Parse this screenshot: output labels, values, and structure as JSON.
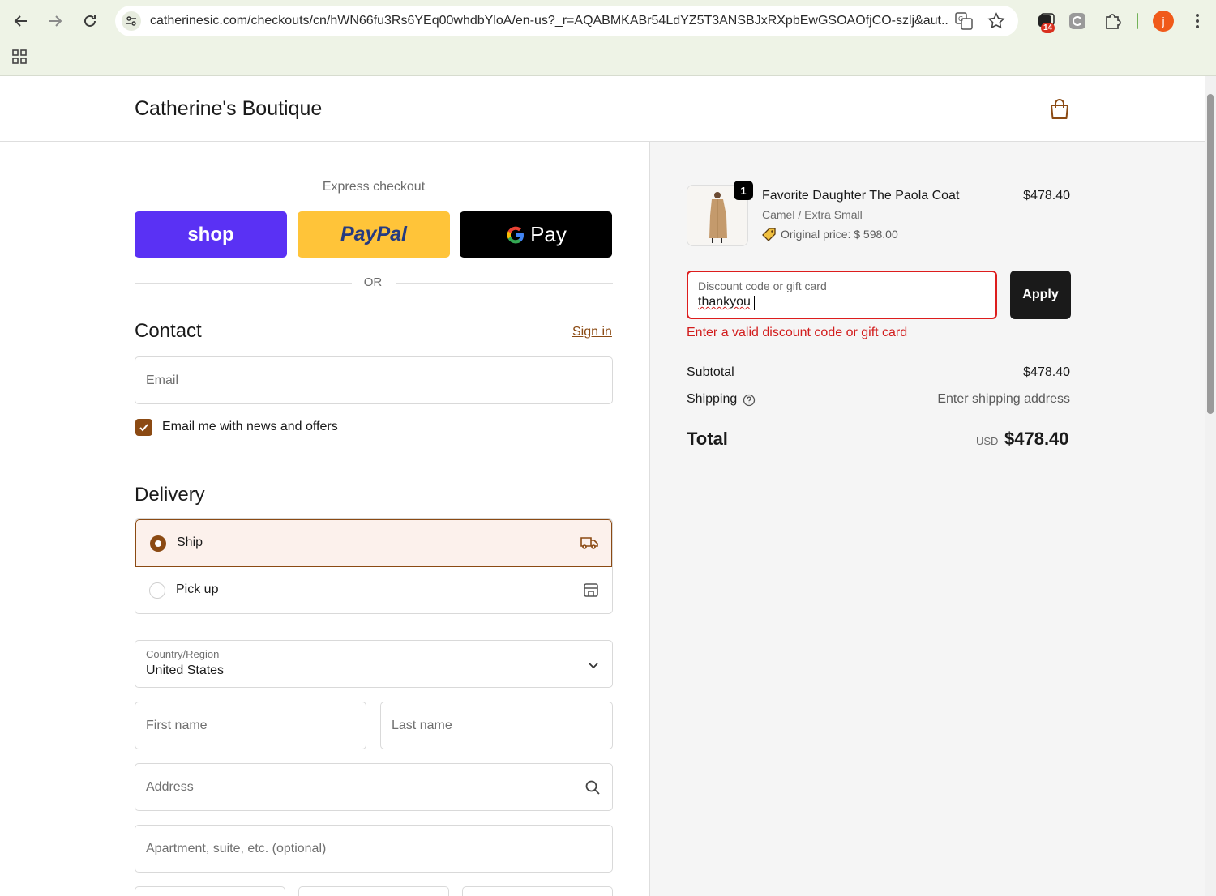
{
  "browser": {
    "url": "catherinesic.com/checkouts/cn/hWN66fu3Rs6YEq00whdbYloA/en-us?_r=AQABMKABr54LdYZ5T3ANSBJxRXpbEwGSOAOfjCO-szlj&aut...",
    "notification_count": "14",
    "profile_initial": "j",
    "icons": [
      "back-icon",
      "forward-icon",
      "reload-icon",
      "site-settings-icon",
      "translate-icon",
      "bookmark-star-icon",
      "extension-icon",
      "puzzle-icon",
      "more-icon",
      "apps-icon"
    ]
  },
  "header": {
    "store_name": "Catherine's Boutique",
    "cart_icon": "shopping-bag-icon"
  },
  "express": {
    "title": "Express checkout",
    "shop_label": "shop",
    "paypal_label": "PayPal",
    "gpay_label": "Pay",
    "or": "OR"
  },
  "contact": {
    "title": "Contact",
    "sign_in": "Sign in",
    "email_placeholder": "Email",
    "newsletter_label": "Email me with news and offers",
    "newsletter_checked": true
  },
  "delivery": {
    "title": "Delivery",
    "options": [
      {
        "label": "Ship",
        "selected": true,
        "icon": "truck-icon"
      },
      {
        "label": "Pick up",
        "selected": false,
        "icon": "store-icon"
      }
    ],
    "country_label": "Country/Region",
    "country_value": "United States",
    "first_name_placeholder": "First name",
    "last_name_placeholder": "Last name",
    "address_placeholder": "Address",
    "apartment_placeholder": "Apartment, suite, etc. (optional)"
  },
  "summary": {
    "product": {
      "quantity": "1",
      "name": "Favorite Daughter The Paola Coat",
      "variant": "Camel / Extra Small",
      "original_price": "Original price: $ 598.00",
      "price": "$478.40"
    },
    "discount_label": "Discount code or gift card",
    "discount_value": "thankyou",
    "apply_label": "Apply",
    "error_text": "Enter a valid discount code or gift card",
    "subtotal_label": "Subtotal",
    "subtotal_value": "$478.40",
    "shipping_label": "Shipping",
    "shipping_value": "Enter shipping address",
    "total_label": "Total",
    "total_currency": "USD",
    "total_value": "$478.40"
  },
  "colors": {
    "accent": "#8b4a13",
    "error": "#d21d1d",
    "shop_pay": "#5a31f4",
    "paypal": "#ffc439"
  }
}
